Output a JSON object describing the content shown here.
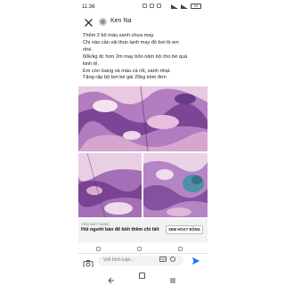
{
  "status_bar": {
    "time": "11:36",
    "battery": "69"
  },
  "header": {
    "author": "Ken Na"
  },
  "post": {
    "lines": [
      "Thêm 2 bộ màu xanh chưa may.",
      "Chị nào cần vải thun lạnh may đồ bơi ib em",
      "nhé.",
      "60k/kg đc hơn 2m may bốn năm bộ cho bé quá",
      "kinh tế.",
      "Em còn loang và màu cà rốt, xanh nhạt.",
      "Tặng rập bộ bơi bé gái 25kg kèm đơn"
    ]
  },
  "ad": {
    "sponsor": "XEM MẶT HÀNG",
    "title": "Hỏi người bán để biết thêm chi tiết",
    "cta": "XEM HOẠT ĐỘNG"
  },
  "comment": {
    "placeholder": "Viết bình luận...",
    "gif": "GIF"
  },
  "colors": {
    "fb_blue": "#1877f2",
    "fabric_purple": "#9b5fb0",
    "fabric_pink": "#e7c3dd",
    "fabric_teal": "#4f8fa8"
  }
}
